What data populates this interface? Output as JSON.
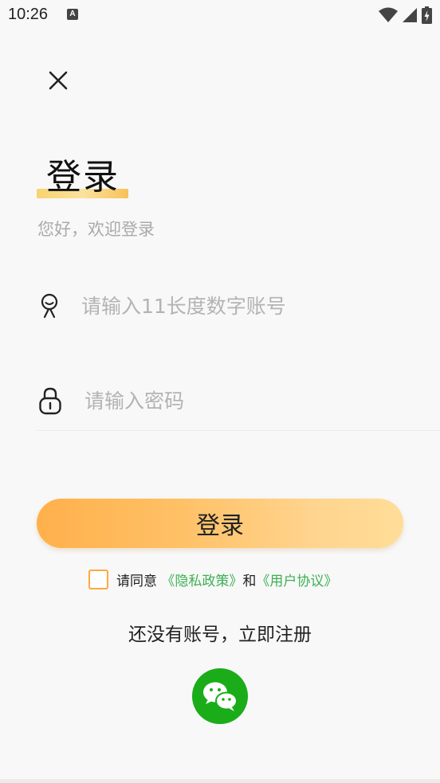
{
  "status_bar": {
    "time": "10:26",
    "badge": "A"
  },
  "header": {
    "title": "登录",
    "subtitle": "您好，欢迎登录"
  },
  "form": {
    "account_placeholder": "请输入11长度数字账号",
    "password_placeholder": "请输入密码",
    "login_label": "登录"
  },
  "agreement": {
    "prefix": "请同意",
    "privacy_link": "《隐私政策》",
    "conjunction": "和",
    "user_link": "《用户协议》"
  },
  "register_label": "还没有账号，立即注册",
  "icons": {
    "close": "close-icon",
    "account": "user-icon",
    "password": "lock-icon",
    "wechat": "wechat-icon"
  },
  "colors": {
    "accent_orange": "#ffb04b",
    "link_green": "#3cb054",
    "wechat_green": "#1aad19"
  }
}
